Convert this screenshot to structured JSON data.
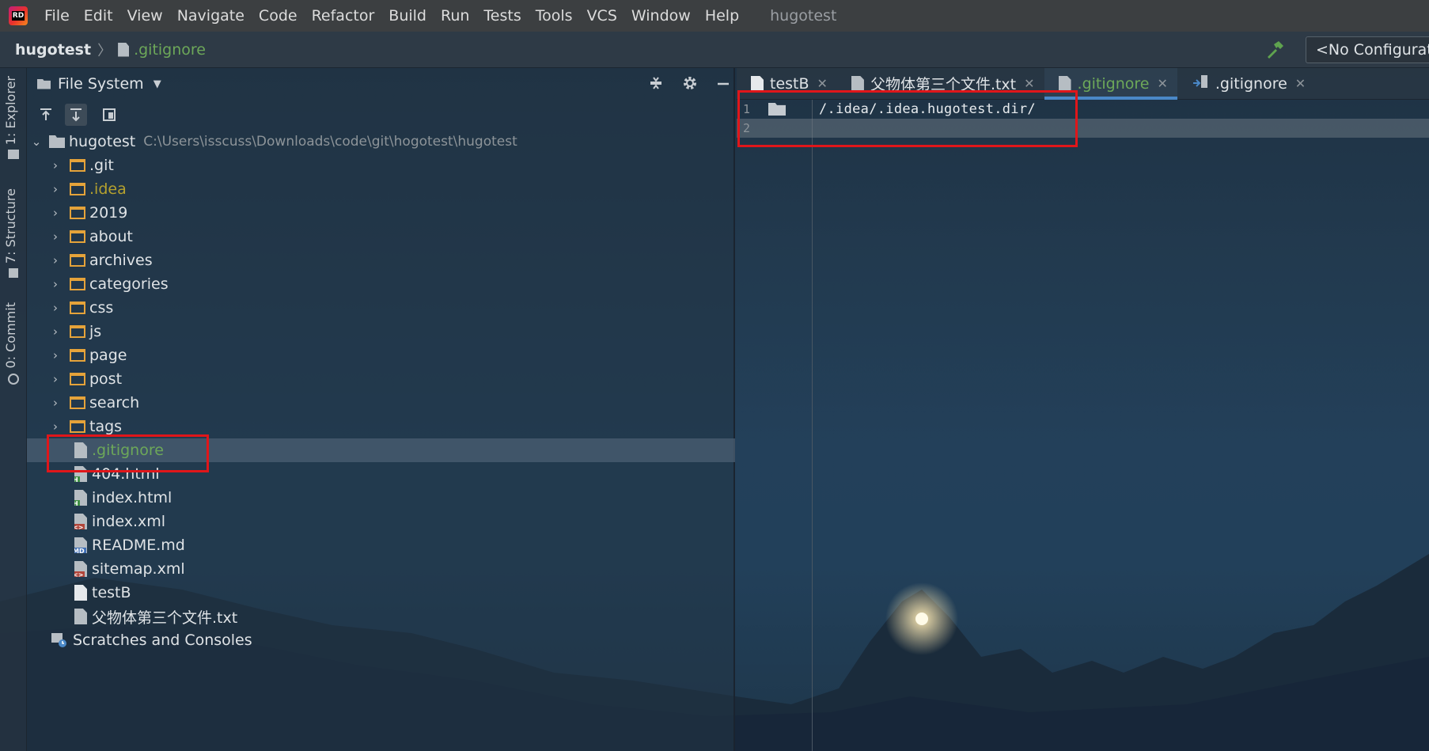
{
  "app": {
    "logo_text": "RD",
    "window_title": "hugotest"
  },
  "menu": [
    {
      "label": "File"
    },
    {
      "label": "Edit"
    },
    {
      "label": "View"
    },
    {
      "label": "Navigate"
    },
    {
      "label": "Code"
    },
    {
      "label": "Refactor"
    },
    {
      "label": "Build"
    },
    {
      "label": "Run"
    },
    {
      "label": "Tests"
    },
    {
      "label": "Tools"
    },
    {
      "label": "VCS"
    },
    {
      "label": "Window"
    },
    {
      "label": "Help"
    }
  ],
  "navbar": {
    "root": "hugotest",
    "separator": "〉",
    "file": ".gitignore",
    "run_config": "<No Configurati"
  },
  "tool_stripe": {
    "explorer": "1: Explorer",
    "structure": "7: Structure",
    "commit": "0: Commit"
  },
  "project_panel": {
    "title": "File System",
    "root_name": "hugotest",
    "root_path": "C:\\Users\\isscuss\\Downloads\\code\\git\\hogotest\\hugotest",
    "folders": [
      {
        "name": ".git"
      },
      {
        "name": ".idea"
      },
      {
        "name": "2019"
      },
      {
        "name": "about"
      },
      {
        "name": "archives"
      },
      {
        "name": "categories"
      },
      {
        "name": "css"
      },
      {
        "name": "js"
      },
      {
        "name": "page"
      },
      {
        "name": "post"
      },
      {
        "name": "search"
      },
      {
        "name": "tags"
      }
    ],
    "files": [
      {
        "name": ".gitignore"
      },
      {
        "name": "404.html",
        "badge": "H"
      },
      {
        "name": "index.html",
        "badge": "H"
      },
      {
        "name": "index.xml",
        "badge": "<>"
      },
      {
        "name": "README.md",
        "badge": "MD"
      },
      {
        "name": "sitemap.xml",
        "badge": "<>"
      },
      {
        "name": "testB"
      },
      {
        "name": "父物体第三个文件.txt"
      }
    ],
    "scratches": "Scratches and Consoles"
  },
  "editor": {
    "tabs": [
      {
        "label": "testB"
      },
      {
        "label": "父物体第三个文件.txt"
      },
      {
        "label": ".gitignore"
      },
      {
        "label": ".gitignore"
      }
    ],
    "lines": [
      {
        "num": "1",
        "text": "/.idea/.idea.hugotest.dir/"
      },
      {
        "num": "2",
        "text": ""
      }
    ]
  },
  "colors": {
    "accent": "#4a88c7",
    "vcs_green": "#6da859",
    "folder_orange": "#e5a33a",
    "highlight_red": "#e0161a"
  }
}
